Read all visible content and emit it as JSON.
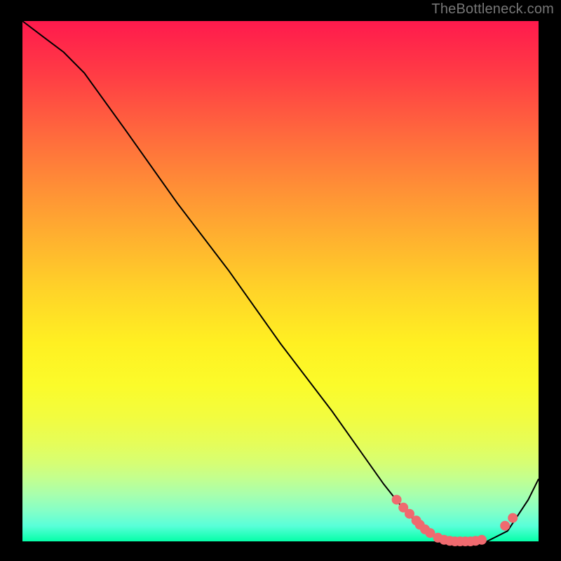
{
  "attribution": "TheBottleneck.com",
  "chart_data": {
    "type": "line",
    "title": "",
    "xlabel": "",
    "ylabel": "",
    "xlim": [
      0,
      100
    ],
    "ylim": [
      0,
      100
    ],
    "series": [
      {
        "name": "curve",
        "x": [
          0,
          4,
          8,
          12,
          20,
          30,
          40,
          50,
          60,
          70,
          74,
          78,
          82,
          86,
          90,
          94,
          98,
          100
        ],
        "y": [
          100,
          97,
          94,
          90,
          79,
          65,
          52,
          38,
          25,
          11,
          6,
          2,
          0,
          0,
          0,
          2,
          8,
          12
        ]
      }
    ],
    "markers": {
      "name": "highlight-dots",
      "x": [
        72.5,
        73.8,
        75.0,
        76.3,
        77.0,
        78.0,
        79.0,
        80.5,
        81.7,
        82.8,
        83.8,
        84.8,
        85.8,
        86.8,
        87.8,
        89.0,
        93.5,
        95.0
      ],
      "y": [
        8.0,
        6.5,
        5.3,
        4.0,
        3.2,
        2.3,
        1.6,
        0.7,
        0.3,
        0.1,
        0.0,
        0.0,
        0.0,
        0.0,
        0.1,
        0.3,
        3.0,
        4.5
      ]
    },
    "gradient_stops": [
      {
        "pct": 0,
        "color": "#ff1a4d"
      },
      {
        "pct": 50,
        "color": "#ffd428"
      },
      {
        "pct": 100,
        "color": "#05ffa8"
      }
    ]
  }
}
